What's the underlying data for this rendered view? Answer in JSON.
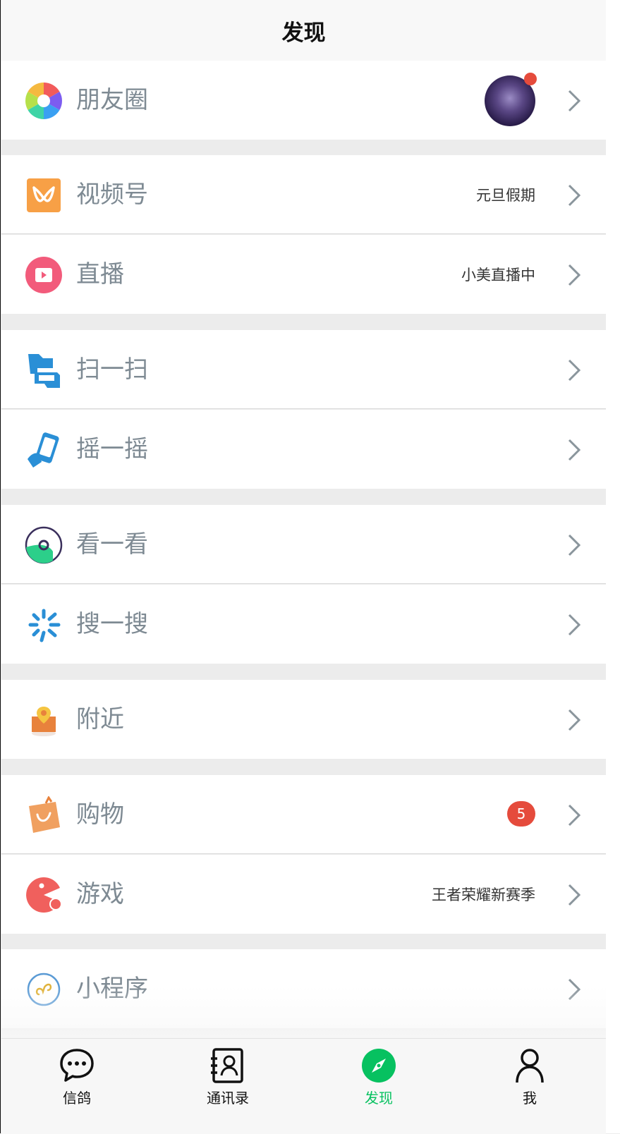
{
  "header": {
    "title": "发现"
  },
  "rows": {
    "moments": {
      "label": "朋友圈"
    },
    "channels": {
      "label": "视频号",
      "extra": "元旦假期"
    },
    "live": {
      "label": "直播",
      "extra": "小美直播中"
    },
    "scan": {
      "label": "扫一扫"
    },
    "shake": {
      "label": "摇一摇"
    },
    "top_stories": {
      "label": "看一看"
    },
    "search": {
      "label": "搜一搜"
    },
    "nearby": {
      "label": "附近"
    },
    "shopping": {
      "label": "购物",
      "badge": "5"
    },
    "games": {
      "label": "游戏",
      "extra": "王者荣耀新赛季"
    },
    "mini_programs": {
      "label": "小程序"
    }
  },
  "tabbar": {
    "chats": "信鸽",
    "contacts": "通讯录",
    "discover": "发现",
    "me": "我"
  },
  "colors": {
    "accent": "#07c160",
    "badge": "#e54b3c"
  }
}
